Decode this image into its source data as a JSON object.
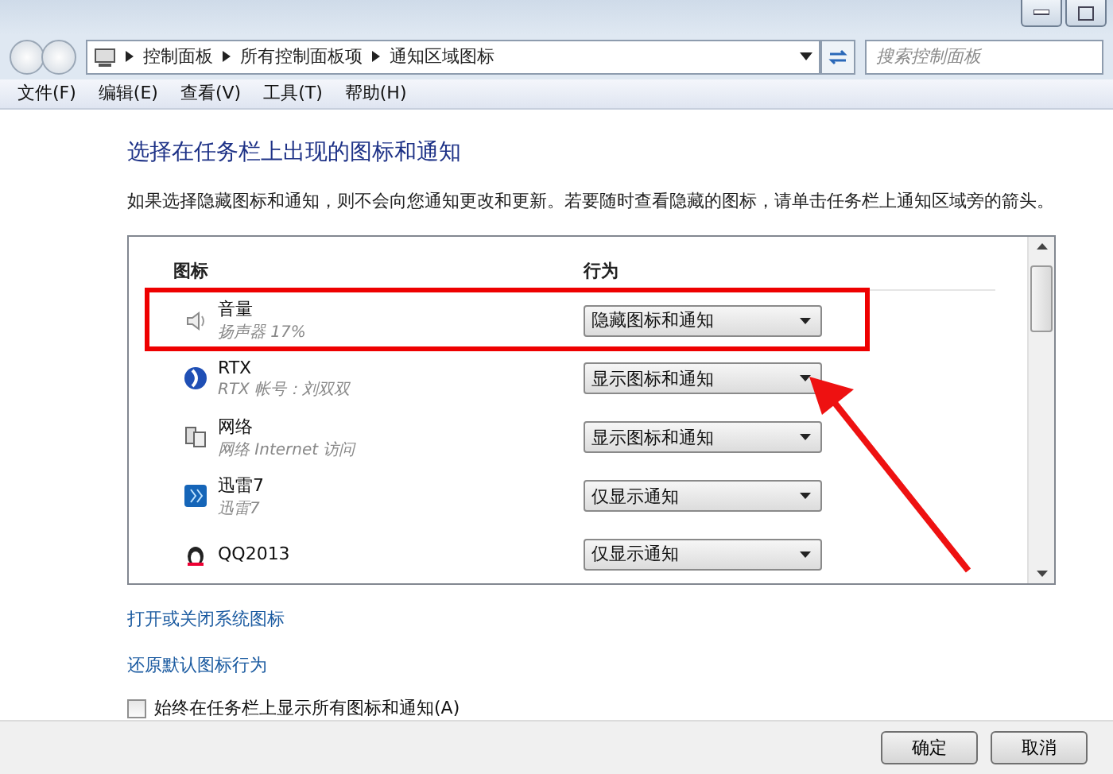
{
  "breadcrumb": [
    "控制面板",
    "所有控制面板项",
    "通知区域图标"
  ],
  "search": {
    "placeholder": "搜索控制面板"
  },
  "menu": [
    "文件(F)",
    "编辑(E)",
    "查看(V)",
    "工具(T)",
    "帮助(H)"
  ],
  "heading": "选择在任务栏上出现的图标和通知",
  "description": "如果选择隐藏图标和通知，则不会向您通知更改和更新。若要随时查看隐藏的图标，请单击任务栏上通知区域旁的箭头。",
  "columns": [
    "图标",
    "行为"
  ],
  "rows": [
    {
      "kind": "speaker",
      "name": "音量",
      "detail": "扬声器 17%",
      "behavior": "隐藏图标和通知",
      "highlighted": true
    },
    {
      "kind": "globe",
      "name": "RTX",
      "detail": "RTX 帐号：刘双双",
      "behavior": "显示图标和通知",
      "highlighted": false
    },
    {
      "kind": "network",
      "name": "网络",
      "detail": "网络 Internet 访问",
      "behavior": "显示图标和通知",
      "highlighted": false
    },
    {
      "kind": "app",
      "name": "迅雷7",
      "detail": "迅雷7",
      "behavior": "仅显示通知",
      "highlighted": false
    },
    {
      "kind": "penguin",
      "name": "QQ2013",
      "behavior": "仅显示通知",
      "highlighted": false
    }
  ],
  "links": [
    "打开或关闭系统图标",
    "还原默认图标行为"
  ],
  "always_show": {
    "label": "始终在任务栏上显示所有图标和通知(A)",
    "checked": false
  },
  "buttons": [
    "确定",
    "取消"
  ]
}
